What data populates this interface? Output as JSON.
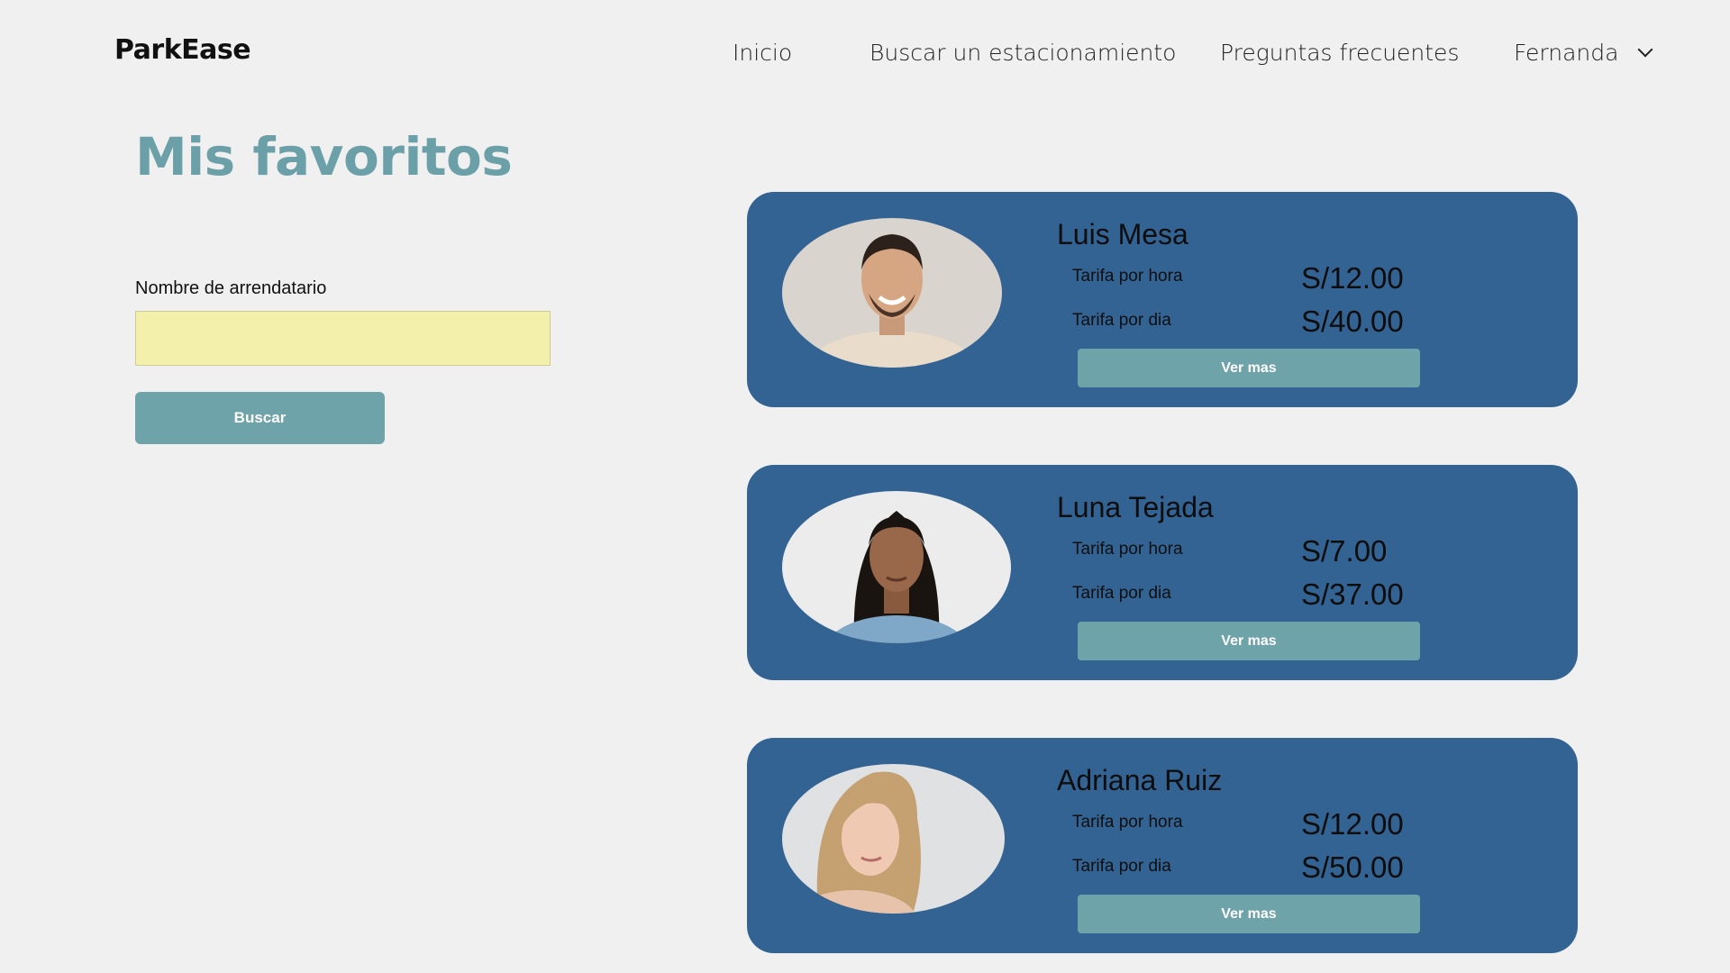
{
  "header": {
    "brand": "ParkEase",
    "nav": {
      "home": "Inicio",
      "find": "Buscar un estacionamiento",
      "faq": "Preguntas frecuentes",
      "user": "Fernanda"
    }
  },
  "main": {
    "title": "Mis favoritos",
    "search": {
      "label": "Nombre de arrendatario",
      "value": "",
      "placeholder": "",
      "button": "Buscar"
    }
  },
  "favorites": [
    {
      "name": "Luis Mesa",
      "hour_label": "Tarifa por hora",
      "hour_rate": "S/12.00",
      "day_label": "Tarifa por dia",
      "day_rate": "S/40.00",
      "button": "Ver mas"
    },
    {
      "name": "Luna Tejada",
      "hour_label": "Tarifa por hora",
      "hour_rate": "S/7.00",
      "day_label": "Tarifa por dia",
      "day_rate": "S/37.00",
      "button": "Ver mas"
    },
    {
      "name": "Adriana Ruiz",
      "hour_label": "Tarifa por hora",
      "hour_rate": "S/12.00",
      "day_label": "Tarifa por dia",
      "day_rate": "S/50.00",
      "button": "Ver mas"
    }
  ],
  "colors": {
    "background": "#f0f0f0",
    "accent": "#6fa3aa",
    "card": "#336393",
    "input": "#f3f0ab"
  },
  "icons": {
    "user_menu": "chevron-down-icon",
    "photos": [
      "avatar-photo",
      "avatar-photo",
      "avatar-photo"
    ]
  }
}
